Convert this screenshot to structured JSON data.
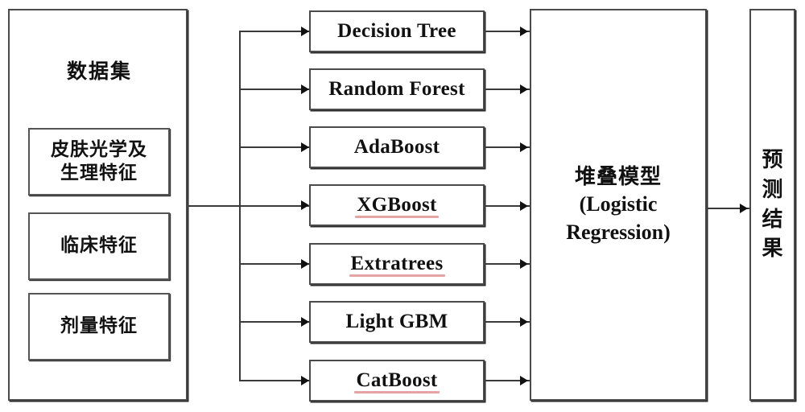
{
  "diagram": {
    "title": "Stacking ensemble model pipeline",
    "colors": {
      "background": "#ffffff",
      "box_border": "#4a4a4a",
      "box_shadow": "#2b2b2b",
      "connector": "#3a3a3a",
      "arrowhead": "#111111",
      "text": "#111111",
      "spellcheck_underline": "#e6a3a3"
    }
  },
  "dataset": {
    "title": "数据集",
    "features": [
      {
        "label": "皮肤光学及\n生理特征",
        "line1": "皮肤光学及",
        "line2": "生理特征"
      },
      {
        "label": "临床特征",
        "line1": "临床特征",
        "line2": ""
      },
      {
        "label": "剂量特征",
        "line1": "剂量特征",
        "line2": ""
      }
    ]
  },
  "base_models": [
    {
      "label": "Decision Tree",
      "misspelled": false
    },
    {
      "label": "Random Forest",
      "misspelled": false
    },
    {
      "label": "AdaBoost",
      "misspelled": false
    },
    {
      "label": "XGBoost",
      "misspelled": true
    },
    {
      "label": "Extratrees",
      "misspelled": true
    },
    {
      "label": "Light GBM",
      "misspelled": false
    },
    {
      "label": "CatBoost",
      "misspelled": true
    }
  ],
  "stacking": {
    "line1": "堆叠模型",
    "line2": "(Logistic",
    "line3": "Regression)"
  },
  "prediction": {
    "chars": [
      "预",
      "测",
      "结",
      "果"
    ],
    "label": "预测结果"
  }
}
